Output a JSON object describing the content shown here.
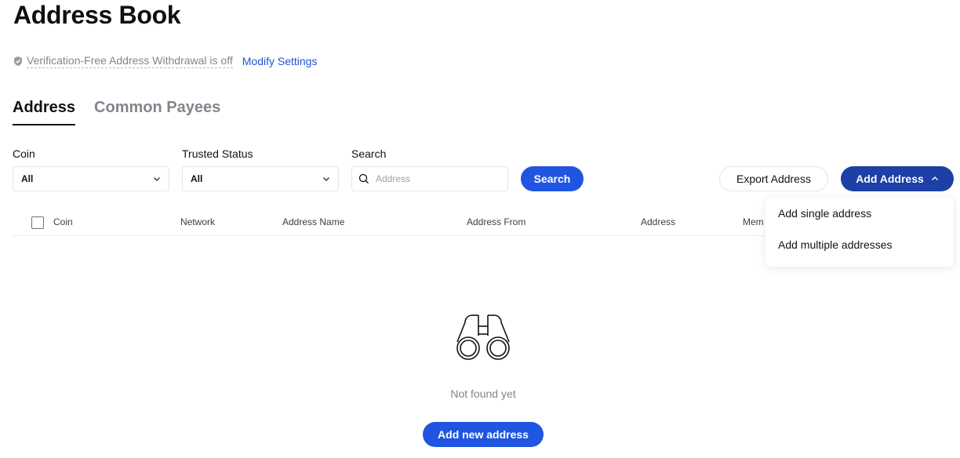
{
  "page": {
    "title": "Address Book"
  },
  "verification": {
    "status_text": "Verification-Free Address Withdrawal is off",
    "modify_link": "Modify Settings"
  },
  "tabs": [
    {
      "label": "Address",
      "active": true
    },
    {
      "label": "Common Payees",
      "active": false
    }
  ],
  "filters": {
    "coin": {
      "label": "Coin",
      "value": "All"
    },
    "trusted_status": {
      "label": "Trusted Status",
      "value": "All"
    },
    "search": {
      "label": "Search",
      "placeholder": "Address",
      "button": "Search"
    }
  },
  "actions": {
    "export": "Export Address",
    "add": "Add Address",
    "add_menu": [
      "Add single address",
      "Add multiple addresses"
    ]
  },
  "table": {
    "columns": [
      "Coin",
      "Network",
      "Address Name",
      "Address From",
      "Address",
      "Mem"
    ]
  },
  "empty_state": {
    "message": "Not found yet",
    "button": "Add new address",
    "icon": "binoculars-icon"
  },
  "colors": {
    "primary": "#1f55e0",
    "primary_dark": "#1d3fa6",
    "link": "#1f55d8",
    "muted_text": "#81858c"
  }
}
